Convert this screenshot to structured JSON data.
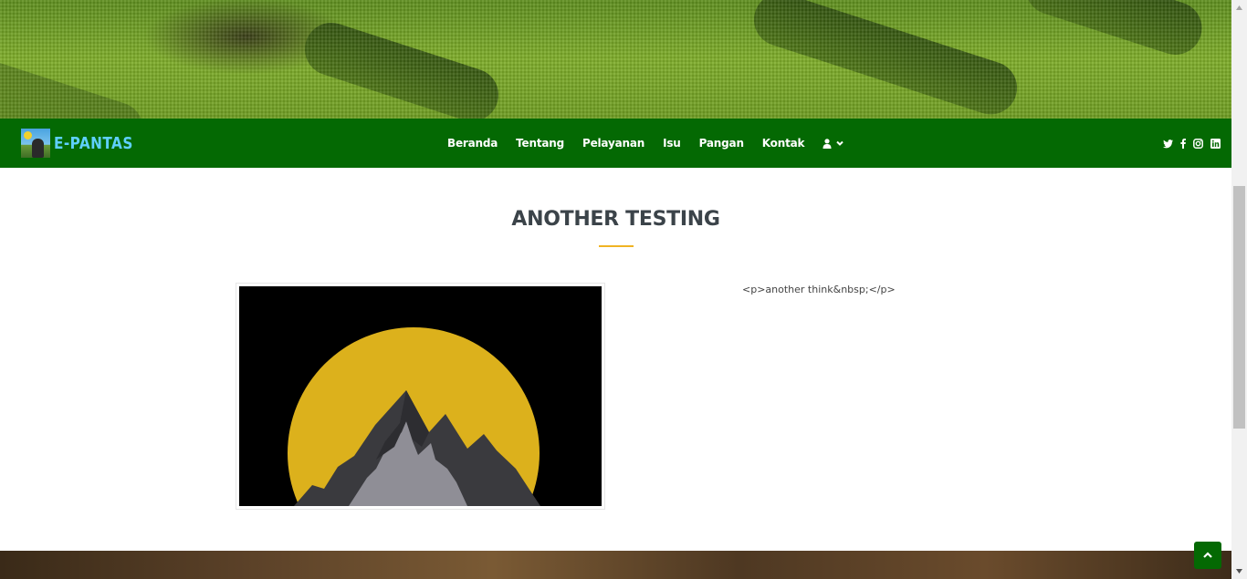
{
  "brand": {
    "name": "E-PANTAS"
  },
  "nav": {
    "items": [
      {
        "label": "Beranda"
      },
      {
        "label": "Tentang"
      },
      {
        "label": "Pelayanan"
      },
      {
        "label": "Isu"
      },
      {
        "label": "Pangan"
      },
      {
        "label": "Kontak"
      }
    ],
    "user_icon": "user-icon",
    "dropdown_icon": "chevron-down-icon"
  },
  "socials": [
    "twitter-icon",
    "facebook-icon",
    "instagram-icon",
    "linkedin-icon"
  ],
  "article": {
    "title": "ANOTHER TESTING",
    "body": "<p>another think&nbsp;</p>"
  },
  "colors": {
    "navbar": "#046903",
    "accent": "#f0b323",
    "title": "#3b4349",
    "sun": "#dcb11c"
  },
  "back_to_top_icon": "chevron-up-icon"
}
